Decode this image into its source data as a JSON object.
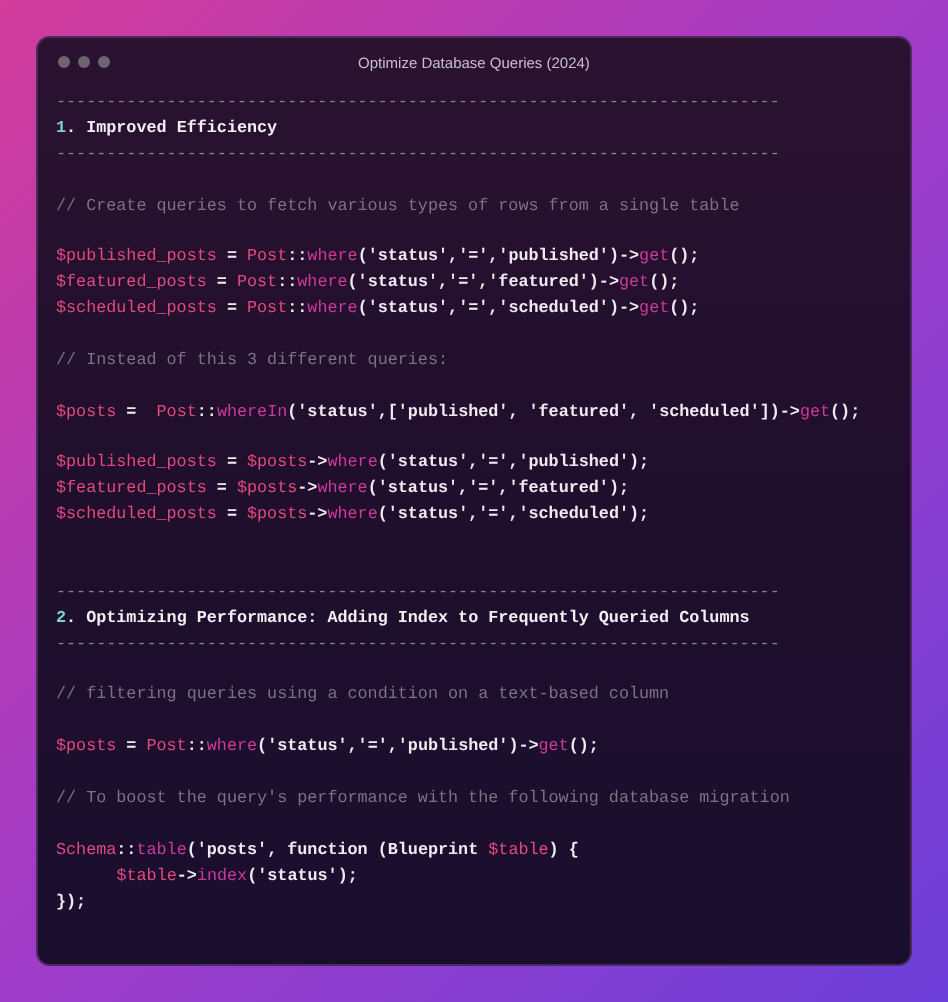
{
  "window": {
    "title": "Optimize Database Queries (2024)"
  },
  "lines": [
    {
      "kind": "rule",
      "tokens": [
        {
          "kind": "dash",
          "text": "------------------------------------------------------------------------"
        }
      ]
    },
    {
      "kind": "heading",
      "tokens": [
        {
          "kind": "num",
          "text": "1"
        },
        {
          "kind": "heading",
          "text": ". Improved Efficiency"
        }
      ]
    },
    {
      "kind": "rule",
      "tokens": [
        {
          "kind": "dash",
          "text": "------------------------------------------------------------------------"
        }
      ]
    },
    {
      "kind": "blank"
    },
    {
      "kind": "comment",
      "tokens": [
        {
          "kind": "comment",
          "text": "// Create queries to fetch various types of rows from a single table"
        }
      ]
    },
    {
      "kind": "blank"
    },
    {
      "kind": "code",
      "tokens": [
        {
          "kind": "var",
          "text": "$published_posts"
        },
        {
          "kind": "plain",
          "text": " = "
        },
        {
          "kind": "cls",
          "text": "Post"
        },
        {
          "kind": "plain",
          "text": "::"
        },
        {
          "kind": "fn",
          "text": "where"
        },
        {
          "kind": "plain",
          "text": "('status','=','published')->"
        },
        {
          "kind": "fn",
          "text": "get"
        },
        {
          "kind": "plain",
          "text": "();"
        }
      ]
    },
    {
      "kind": "code",
      "tokens": [
        {
          "kind": "var",
          "text": "$featured_posts"
        },
        {
          "kind": "plain",
          "text": " = "
        },
        {
          "kind": "cls",
          "text": "Post"
        },
        {
          "kind": "plain",
          "text": "::"
        },
        {
          "kind": "fn",
          "text": "where"
        },
        {
          "kind": "plain",
          "text": "('status','=','featured')->"
        },
        {
          "kind": "fn",
          "text": "get"
        },
        {
          "kind": "plain",
          "text": "();"
        }
      ]
    },
    {
      "kind": "code",
      "tokens": [
        {
          "kind": "var",
          "text": "$scheduled_posts"
        },
        {
          "kind": "plain",
          "text": " = "
        },
        {
          "kind": "cls",
          "text": "Post"
        },
        {
          "kind": "plain",
          "text": "::"
        },
        {
          "kind": "fn",
          "text": "where"
        },
        {
          "kind": "plain",
          "text": "('status','=','scheduled')->"
        },
        {
          "kind": "fn",
          "text": "get"
        },
        {
          "kind": "plain",
          "text": "();"
        }
      ]
    },
    {
      "kind": "blank"
    },
    {
      "kind": "comment",
      "tokens": [
        {
          "kind": "comment",
          "text": "// Instead of this 3 different queries:"
        }
      ]
    },
    {
      "kind": "blank"
    },
    {
      "kind": "code",
      "tokens": [
        {
          "kind": "var",
          "text": "$posts"
        },
        {
          "kind": "plain",
          "text": " =  "
        },
        {
          "kind": "cls",
          "text": "Post"
        },
        {
          "kind": "plain",
          "text": "::"
        },
        {
          "kind": "fn",
          "text": "whereIn"
        },
        {
          "kind": "plain",
          "text": "('status',['published', 'featured', 'scheduled'])->"
        },
        {
          "kind": "fn",
          "text": "get"
        },
        {
          "kind": "plain",
          "text": "();"
        }
      ]
    },
    {
      "kind": "blank"
    },
    {
      "kind": "code",
      "tokens": [
        {
          "kind": "var",
          "text": "$published_posts"
        },
        {
          "kind": "plain",
          "text": " = "
        },
        {
          "kind": "var",
          "text": "$posts"
        },
        {
          "kind": "plain",
          "text": "->"
        },
        {
          "kind": "fn",
          "text": "where"
        },
        {
          "kind": "plain",
          "text": "('status','=','published');"
        }
      ]
    },
    {
      "kind": "code",
      "tokens": [
        {
          "kind": "var",
          "text": "$featured_posts"
        },
        {
          "kind": "plain",
          "text": " = "
        },
        {
          "kind": "var",
          "text": "$posts"
        },
        {
          "kind": "plain",
          "text": "->"
        },
        {
          "kind": "fn",
          "text": "where"
        },
        {
          "kind": "plain",
          "text": "('status','=','featured');"
        }
      ]
    },
    {
      "kind": "code",
      "tokens": [
        {
          "kind": "var",
          "text": "$scheduled_posts"
        },
        {
          "kind": "plain",
          "text": " = "
        },
        {
          "kind": "var",
          "text": "$posts"
        },
        {
          "kind": "plain",
          "text": "->"
        },
        {
          "kind": "fn",
          "text": "where"
        },
        {
          "kind": "plain",
          "text": "('status','=','scheduled');"
        }
      ]
    },
    {
      "kind": "blank"
    },
    {
      "kind": "blank"
    },
    {
      "kind": "rule",
      "tokens": [
        {
          "kind": "dash",
          "text": "------------------------------------------------------------------------"
        }
      ]
    },
    {
      "kind": "heading",
      "tokens": [
        {
          "kind": "num",
          "text": "2"
        },
        {
          "kind": "heading",
          "text": ". Optimizing Performance: Adding Index to Frequently Queried Columns"
        }
      ]
    },
    {
      "kind": "rule",
      "tokens": [
        {
          "kind": "dash",
          "text": "------------------------------------------------------------------------"
        }
      ]
    },
    {
      "kind": "blank"
    },
    {
      "kind": "comment",
      "tokens": [
        {
          "kind": "comment",
          "text": "// filtering queries using a condition on a text-based column"
        }
      ]
    },
    {
      "kind": "blank"
    },
    {
      "kind": "code",
      "tokens": [
        {
          "kind": "var",
          "text": "$posts"
        },
        {
          "kind": "plain",
          "text": " = "
        },
        {
          "kind": "cls",
          "text": "Post"
        },
        {
          "kind": "plain",
          "text": "::"
        },
        {
          "kind": "fn",
          "text": "where"
        },
        {
          "kind": "plain",
          "text": "('status','=','published')->"
        },
        {
          "kind": "fn",
          "text": "get"
        },
        {
          "kind": "plain",
          "text": "();"
        }
      ]
    },
    {
      "kind": "blank"
    },
    {
      "kind": "comment",
      "tokens": [
        {
          "kind": "comment",
          "text": "// To boost the query's performance with the following database migration"
        }
      ]
    },
    {
      "kind": "blank"
    },
    {
      "kind": "code",
      "tokens": [
        {
          "kind": "cls",
          "text": "Schema"
        },
        {
          "kind": "plain",
          "text": "::"
        },
        {
          "kind": "fn",
          "text": "table"
        },
        {
          "kind": "plain",
          "text": "('posts', function (Blueprint "
        },
        {
          "kind": "var",
          "text": "$table"
        },
        {
          "kind": "plain",
          "text": ") {"
        }
      ]
    },
    {
      "kind": "code_indented",
      "tokens": [
        {
          "kind": "var",
          "text": "$table"
        },
        {
          "kind": "plain",
          "text": "->"
        },
        {
          "kind": "fn",
          "text": "index"
        },
        {
          "kind": "plain",
          "text": "('status');"
        }
      ]
    },
    {
      "kind": "code",
      "tokens": [
        {
          "kind": "plain",
          "text": "});"
        }
      ]
    }
  ]
}
